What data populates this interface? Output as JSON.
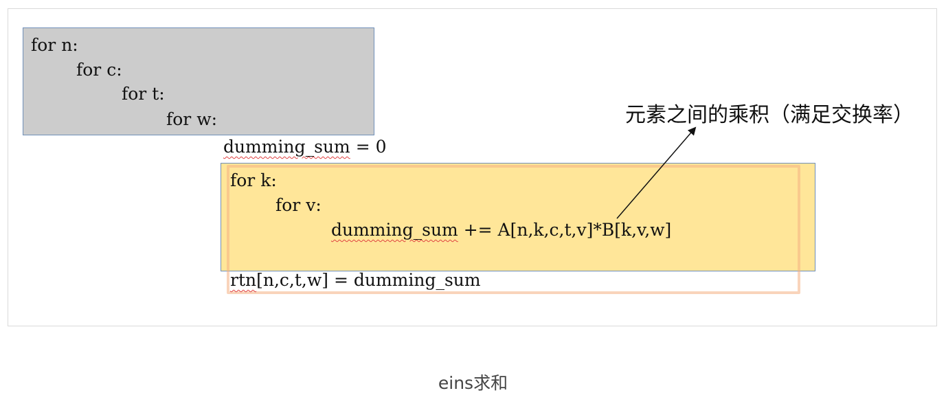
{
  "loops_outer": {
    "line1": "for n:",
    "line2": "for c:",
    "line3": "for t:",
    "line4": "for w:"
  },
  "init": {
    "var": "dumming_sum",
    "rest": " = 0"
  },
  "loops_inner": {
    "line1": "for k:",
    "line2": "for v:",
    "body_var": "dumming_sum",
    "body_rest": " += A[n,k,c,t,v]*B[k,v,w]"
  },
  "result": {
    "var": "rtn",
    "rest": "[n,c,t,w] = dumming_sum"
  },
  "annotation": "元素之间的乘积（满足交换率）",
  "caption": "eins求和",
  "colors": {
    "gray_box": "#cccccc",
    "yellow_box": "#ffe699",
    "outline": "#f4b183",
    "box_border": "#6f8fb8"
  }
}
